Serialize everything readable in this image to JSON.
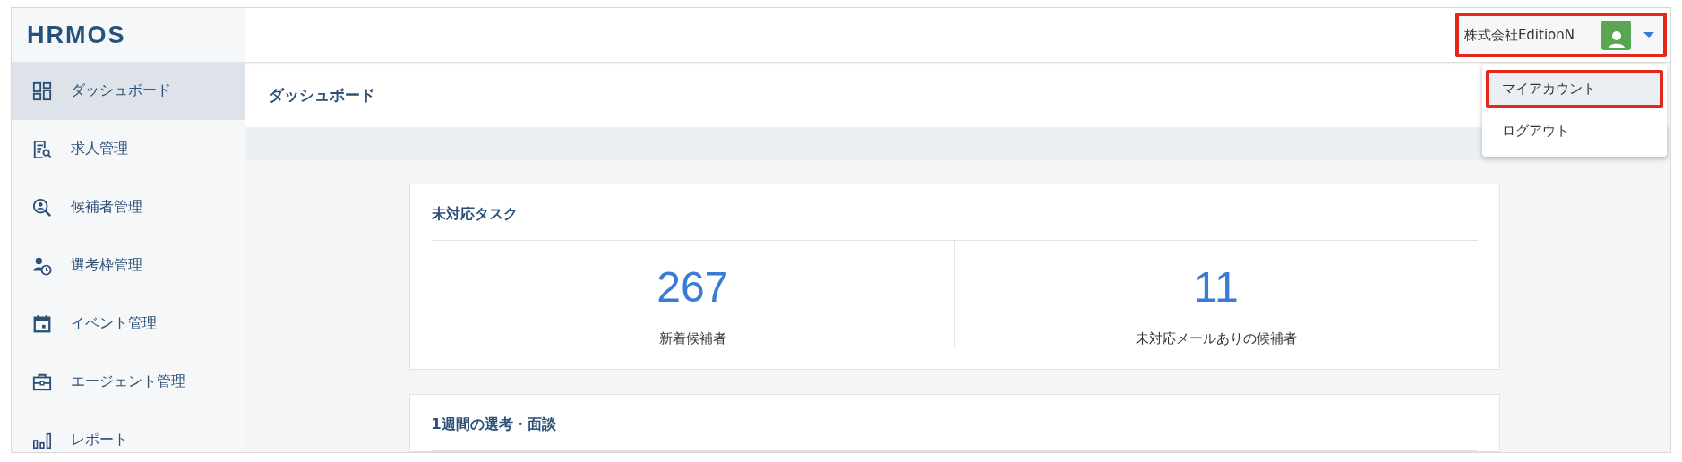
{
  "logo": "HRMOS",
  "sidebar": {
    "items": [
      {
        "label": "ダッシュボード",
        "kind": "dashboard",
        "selected": true
      },
      {
        "label": "求人管理",
        "kind": "job",
        "selected": false
      },
      {
        "label": "候補者管理",
        "kind": "candidate",
        "selected": false
      },
      {
        "label": "選考枠管理",
        "kind": "slot",
        "selected": false
      },
      {
        "label": "イベント管理",
        "kind": "event",
        "selected": false
      },
      {
        "label": "エージェント管理",
        "kind": "agent",
        "selected": false
      },
      {
        "label": "レポート",
        "kind": "report",
        "selected": false
      }
    ]
  },
  "header": {
    "company": "株式会社EditionN",
    "highlighted": true
  },
  "user_menu": {
    "items": [
      {
        "label": "マイアカウント",
        "selected": true,
        "highlighted": true
      },
      {
        "label": "ログアウト",
        "selected": false,
        "highlighted": false
      }
    ]
  },
  "page_title": "ダッシュボード",
  "cards": [
    {
      "title": "未対応タスク",
      "stats": [
        {
          "value": "267",
          "label": "新着候補者"
        },
        {
          "value": "11",
          "label": "未対応メールありの候補者"
        }
      ]
    },
    {
      "title": "1週間の選考・面談"
    }
  ]
}
